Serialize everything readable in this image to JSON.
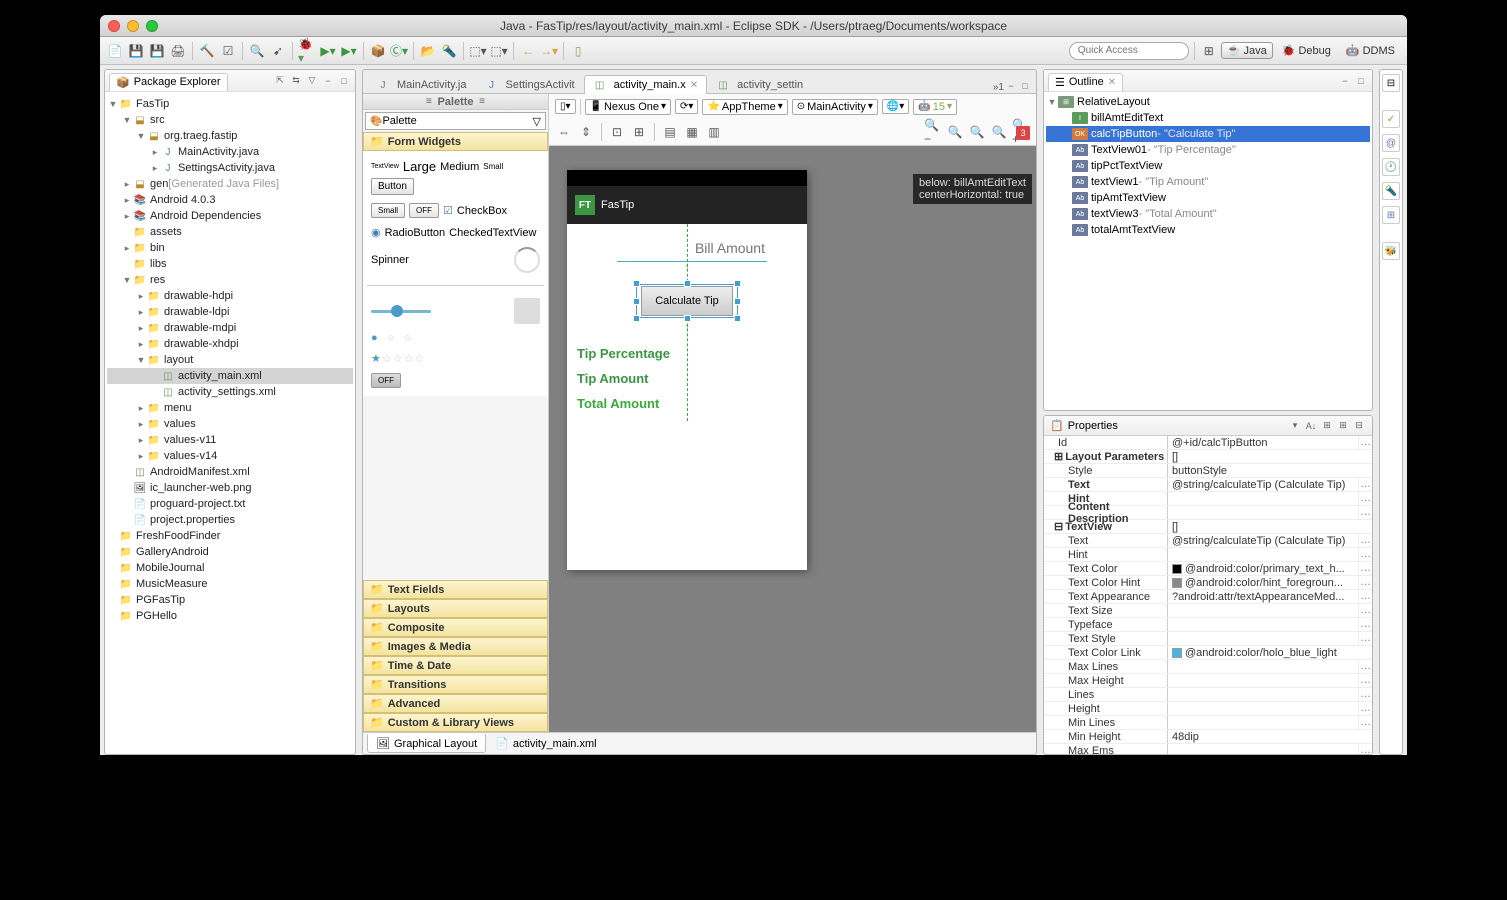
{
  "title": "Java - FasTip/res/layout/activity_main.xml - Eclipse SDK - /Users/ptraeg/Documents/workspace",
  "quick_access_placeholder": "Quick Access",
  "perspectives": {
    "java": "Java",
    "debug": "Debug",
    "ddms": "DDMS"
  },
  "package_explorer": {
    "title": "Package Explorer",
    "tree": {
      "p1": "FasTip",
      "p1_src": "src",
      "p1_pkg": "org.traeg.fastip",
      "p1_f1": "MainActivity.java",
      "p1_f2": "SettingsActivity.java",
      "p1_gen": "gen",
      "p1_gen_note": "[Generated Java Files]",
      "p1_lib1": "Android 4.0.3",
      "p1_lib2": "Android Dependencies",
      "p1_assets": "assets",
      "p1_bin": "bin",
      "p1_libs": "libs",
      "p1_res": "res",
      "dhd": "drawable-hdpi",
      "dld": "drawable-ldpi",
      "dmd": "drawable-mdpi",
      "dxd": "drawable-xhdpi",
      "layout": "layout",
      "am": "activity_main.xml",
      "as": "activity_settings.xml",
      "menu": "menu",
      "values": "values",
      "v11": "values-v11",
      "v14": "values-v14",
      "manifest": "AndroidManifest.xml",
      "iclaunch": "ic_launcher-web.png",
      "proguard": "proguard-project.txt",
      "projprops": "project.properties",
      "p2": "FreshFoodFinder",
      "p3": "GalleryAndroid",
      "p4": "MobileJournal",
      "p5": "MusicMeasure",
      "p6": "PGFasTip",
      "p7": "PGHello"
    }
  },
  "editor": {
    "tabs": {
      "t1": "MainActivity.ja",
      "t2": "SettingsActivit",
      "t3": "activity_main.x",
      "t4": "activity_settin"
    },
    "overflow": "»1",
    "palette": {
      "title": "Palette",
      "dropdown": "Palette",
      "sections": {
        "fw": "Form Widgets",
        "tf": "Text Fields",
        "ly": "Layouts",
        "co": "Composite",
        "im": "Images & Media",
        "td": "Time & Date",
        "tr": "Transitions",
        "ad": "Advanced",
        "cl": "Custom & Library Views"
      },
      "widgets": {
        "tv": "TextView",
        "lg": "Large",
        "md": "Medium",
        "sm": "Small",
        "btn": "Button",
        "sm2": "Small",
        "off": "OFF",
        "cb": "CheckBox",
        "rb": "RadioButton",
        "ctv": "CheckedTextView",
        "spn": "Spinner",
        "off2": "OFF"
      }
    },
    "canvas_toolbar": {
      "device": "Nexus One",
      "theme": "AppTheme",
      "activity": "MainActivity",
      "api": "15"
    },
    "device": {
      "app_name": "FasTip",
      "bill_hint": "Bill Amount",
      "calc": "Calculate Tip",
      "tp": "Tip Percentage",
      "ta": "Tip Amount",
      "tot": "Total Amount"
    },
    "tooltip": {
      "l1": "below: billAmtEditText",
      "l2": "centerHorizontal: true"
    },
    "errors": "3",
    "bottom_tabs": {
      "gl": "Graphical Layout",
      "xml": "activity_main.xml"
    }
  },
  "outline": {
    "title": "Outline",
    "root": "RelativeLayout",
    "items": {
      "i1": "billAmtEditText",
      "i2": "calcTipButton",
      "i2d": " - \"Calculate Tip\"",
      "i3": "TextView01",
      "i3d": " - \"Tip Percentage\"",
      "i4": "tipPctTextView",
      "i5": "textView1",
      "i5d": " - \"Tip Amount\"",
      "i6": "tipAmtTextView",
      "i7": "textView3",
      "i7d": " - \"Total Amount\"",
      "i8": "totalAmtTextView"
    }
  },
  "properties": {
    "title": "Properties",
    "rows": {
      "id": "Id",
      "id_v": "@+id/calcTipButton",
      "lp": "Layout Parameters",
      "lp_v": "[]",
      "style": "Style",
      "style_v": "buttonStyle",
      "text": "Text",
      "text_v": "@string/calculateTip (Calculate Tip)",
      "hint": "Hint",
      "cd": "Content Description",
      "tvh": "TextView",
      "tvh_v": "[]",
      "text2": "Text",
      "text2_v": "@string/calculateTip (Calculate Tip)",
      "hint2": "Hint",
      "tc": "Text Color",
      "tc_v": "@android:color/primary_text_h...",
      "tch": "Text Color Hint",
      "tch_v": "@android:color/hint_foregroun...",
      "ta": "Text Appearance",
      "ta_v": "?android:attr/textAppearanceMed...",
      "ts": "Text Size",
      "tf": "Typeface",
      "tst": "Text Style",
      "tcl": "Text Color Link",
      "tcl_v": "@android:color/holo_blue_light",
      "ml": "Max Lines",
      "mh": "Max Height",
      "ln": "Lines",
      "ht": "Height",
      "minl": "Min Lines",
      "minh": "Min Height",
      "minh_v": "48dip",
      "me": "Max Ems"
    }
  }
}
